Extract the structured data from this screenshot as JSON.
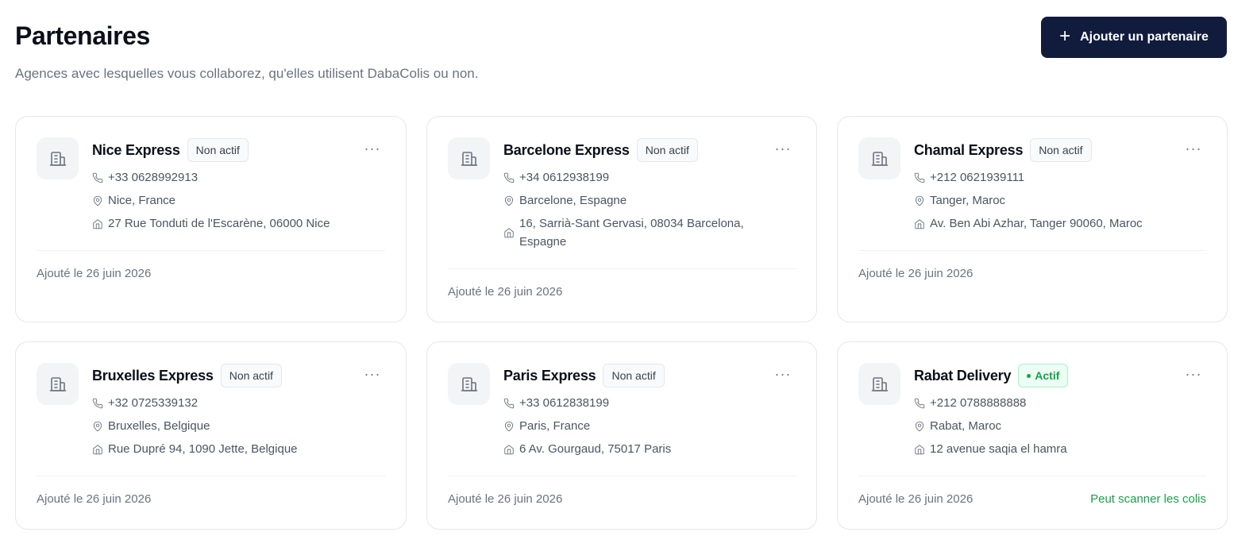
{
  "header": {
    "title": "Partenaires",
    "subtitle": "Agences avec lesquelles vous collaborez, qu'elles utilisent DabaColis ou non.",
    "add_button_label": "Ajouter un partenaire",
    "add_button_icon": "plus-icon"
  },
  "colors": {
    "primary_button": "#111c3d",
    "active_badge": "#16a34a",
    "text_muted": "#6b7280"
  },
  "partners": [
    {
      "name": "Nice Express",
      "status": "Non actif",
      "phone": "+33 0628992913",
      "city": "Nice, France",
      "address": "27 Rue Tonduti de l'Escarène, 06000 Nice",
      "added": "Ajouté le 26 juin 2026",
      "extra": ""
    },
    {
      "name": "Barcelone Express",
      "status": "Non actif",
      "phone": "+34 0612938199",
      "city": "Barcelone, Espagne",
      "address": "16, Sarrià-Sant Gervasi, 08034 Barcelona, Espagne",
      "added": "Ajouté le 26 juin 2026",
      "extra": ""
    },
    {
      "name": "Chamal Express",
      "status": "Non actif",
      "phone": "+212 0621939111",
      "city": "Tanger, Maroc",
      "address": "Av. Ben Abi Azhar, Tanger 90060, Maroc",
      "added": "Ajouté le 26 juin 2026",
      "extra": ""
    },
    {
      "name": "Bruxelles Express",
      "status": "Non actif",
      "phone": "+32 0725339132",
      "city": "Bruxelles, Belgique",
      "address": "Rue Dupré 94, 1090 Jette, Belgique",
      "added": "Ajouté le 26 juin 2026",
      "extra": ""
    },
    {
      "name": "Paris Express",
      "status": "Non actif",
      "phone": "+33 0612838199",
      "city": "Paris, France",
      "address": "6 Av. Gourgaud, 75017 Paris",
      "added": "Ajouté le 26 juin 2026",
      "extra": ""
    },
    {
      "name": "Rabat Delivery",
      "status": "Actif",
      "phone": "+212 0788888888",
      "city": "Rabat, Maroc",
      "address": "12 avenue saqia el hamra",
      "added": "Ajouté le 26 juin 2026",
      "extra": "Peut scanner les colis"
    }
  ],
  "icons": {
    "avatar": "building-icon",
    "phone": "phone-icon",
    "location": "map-pin-icon",
    "address": "home-icon",
    "menu": "more-horizontal-icon"
  }
}
